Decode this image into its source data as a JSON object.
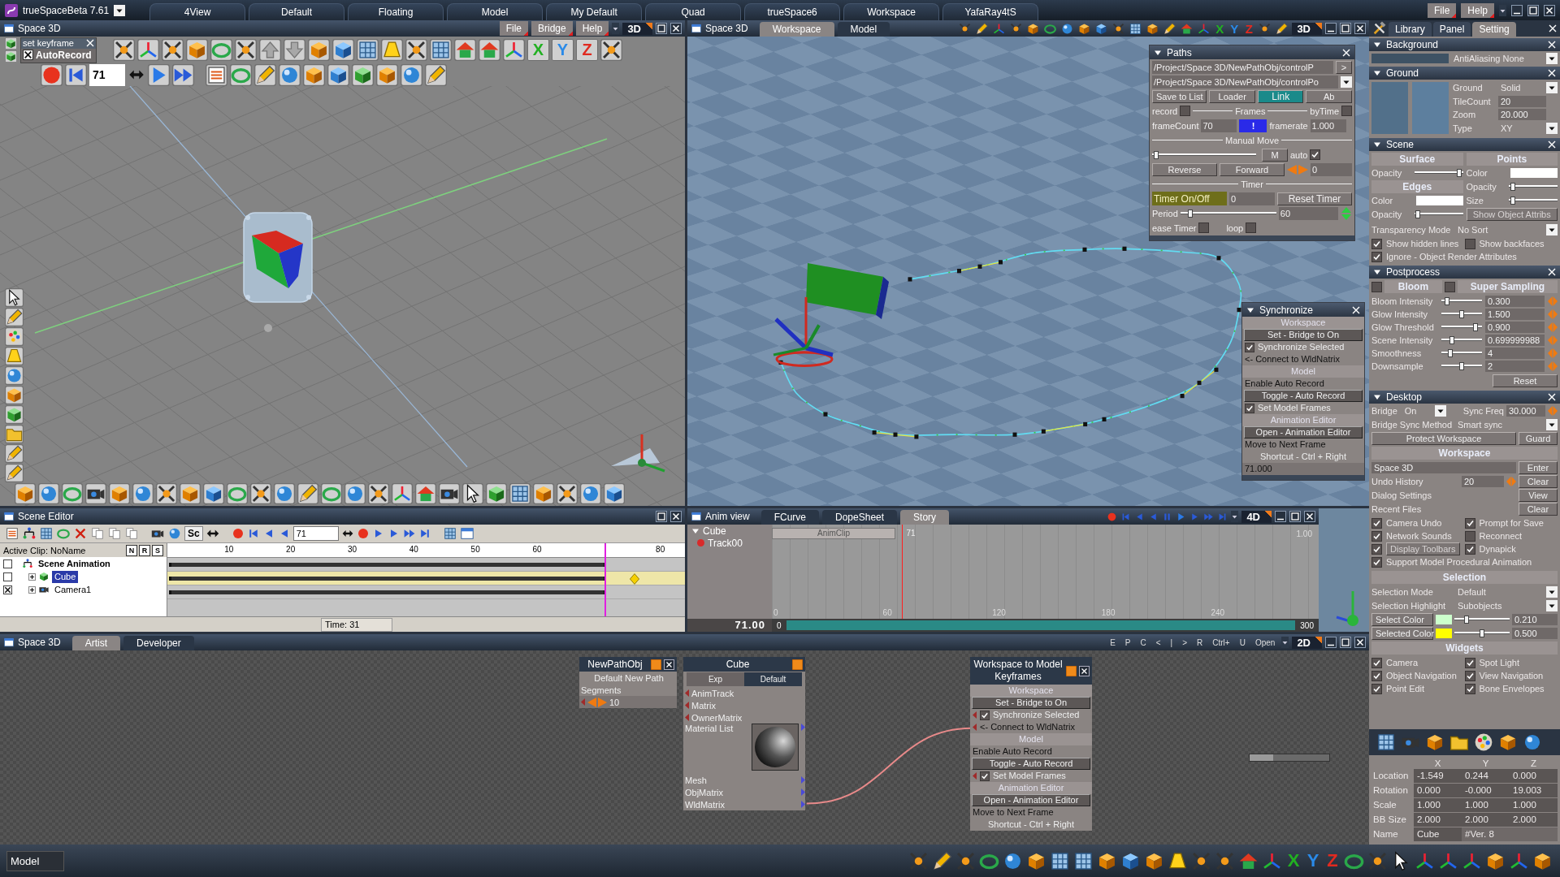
{
  "title_bar": {
    "app_title": "trueSpaceBeta 7.61",
    "layouts": [
      "4View",
      "Default",
      "Floating",
      "Model",
      "My Default",
      "Quad",
      "trueSpace6",
      "Workspace",
      "YafaRay4tS"
    ],
    "menu": [
      "File",
      "Help"
    ]
  },
  "model_view": {
    "title": "Space 3D",
    "menu": [
      "File",
      "Bridge",
      "Help"
    ],
    "mode": "3D",
    "keyframe": {
      "title": "set keyframe",
      "label": "AutoRecord",
      "checked": true
    },
    "axis_letters": [
      "X",
      "Y",
      "Z"
    ],
    "frame": "71"
  },
  "workspace_view": {
    "title": "Space 3D",
    "tabs": [
      {
        "label": "Workspace",
        "selected": true
      },
      {
        "label": "Model",
        "selected": false
      }
    ],
    "axis_letters": [
      "X",
      "Y",
      "Z"
    ],
    "mode": "3D"
  },
  "paths_panel": {
    "title": "Paths",
    "paths": [
      {
        "value": "/Project/Space 3D/NewPathObj/controlP",
        "kind": "button",
        "button": ">"
      },
      {
        "value": "/Project/Space 3D/NewPathObj/controlPo",
        "kind": "dropdown"
      }
    ],
    "buttons": [
      {
        "label": "Save to List",
        "selected": false
      },
      {
        "label": "Loader",
        "selected": false
      },
      {
        "label": "Link",
        "selected": true
      },
      {
        "label": "Ab",
        "selected": false
      }
    ],
    "record": {
      "label": "record",
      "checked": false
    },
    "frames_label": "Frames",
    "by_time": {
      "label": "byTime",
      "checked": false
    },
    "frame_count": {
      "label": "frameCount",
      "value": "70"
    },
    "apply": "!",
    "framerate": {
      "label": "framerate",
      "value": "1.000"
    },
    "manual_label": "Manual Move",
    "manual": {
      "level": 0.02
    },
    "m_button": "M",
    "auto": {
      "label": "auto",
      "checked": true
    },
    "reverse": "Reverse",
    "forward": "Forward",
    "step_value": "0",
    "timer_label": "Timer",
    "timer_toggle": {
      "label": "Timer On/Off",
      "on": true
    },
    "timer_value": "0",
    "reset": "Reset Timer",
    "period": {
      "label": "Period",
      "level": 0.08,
      "value": "60"
    },
    "ease": {
      "label": "ease Timer",
      "checked": false
    },
    "loop": {
      "label": "loop",
      "checked": false
    }
  },
  "sync_panel": {
    "title": "Synchronize",
    "rows": [
      {
        "kind": "header",
        "label": "Workspace"
      },
      {
        "kind": "button",
        "label": "Set - Bridge to On"
      },
      {
        "kind": "check",
        "label": "Synchronize Selected",
        "checked": true
      },
      {
        "kind": "input",
        "label": "<- Connect to WldNatrix"
      },
      {
        "kind": "header",
        "label": "Model"
      },
      {
        "kind": "text",
        "label": "Enable Auto Record"
      },
      {
        "kind": "button",
        "label": "Toggle - Auto Record"
      },
      {
        "kind": "check",
        "label": "Set Model Frames",
        "checked": true
      },
      {
        "kind": "header",
        "label": "Animation Editor"
      },
      {
        "kind": "button",
        "label": "Open - Animation Editor"
      },
      {
        "kind": "text",
        "label": "Move to Next Frame"
      },
      {
        "kind": "hint",
        "label": "Shortcut - Ctrl + Right"
      },
      {
        "kind": "value",
        "label": "71.000"
      }
    ]
  },
  "scene_editor": {
    "title": "Scene Editor",
    "tool_label": "Sc",
    "frame": "71",
    "active_clip": "Active Clip: NoName",
    "clip_buttons": [
      "N",
      "R",
      "S"
    ],
    "ruler": [
      "10",
      "20",
      "30",
      "40",
      "50",
      "60",
      "80"
    ],
    "playhead": {
      "level": 0.845
    },
    "tree": [
      {
        "label": "Scene Animation",
        "kind": "scene",
        "selected": false,
        "checked": false,
        "children": [
          {
            "label": "Cube",
            "kind": "mesh",
            "selected": true,
            "checked": false,
            "expanded": false
          },
          {
            "label": "Camera1",
            "kind": "camera",
            "selected": false,
            "checked": true,
            "expanded": false
          }
        ]
      }
    ],
    "time": "Time: 31"
  },
  "anim_view": {
    "title": "Anim view",
    "tabs": [
      {
        "label": "FCurve",
        "selected": false
      },
      {
        "label": "DopeSheet",
        "selected": false
      },
      {
        "label": "Story",
        "selected": true
      }
    ],
    "mode": "4D",
    "tree": [
      {
        "label": "Cube",
        "expanded": true,
        "children": [
          {
            "label": "Track00"
          }
        ]
      }
    ],
    "clip": "AnimClip",
    "clip_frame": "71",
    "clip_end": "1.00",
    "grid_labels": [
      "0",
      "60",
      "120",
      "180",
      "240"
    ],
    "frame": "71.00",
    "range_start": "0",
    "range_end": "300",
    "playhead": {
      "level": 0.237
    }
  },
  "node_editor": {
    "title": "Space 3D",
    "tabs": [
      {
        "label": "Artist",
        "selected": true
      },
      {
        "label": "Developer",
        "selected": false
      }
    ],
    "toolbar": [
      "E",
      "P",
      "C",
      "<",
      "|",
      ">",
      "R",
      "Ctrl+",
      "U",
      "Open"
    ],
    "mode": "2D",
    "nodes": [
      {
        "kind": "path",
        "title": "NewPathObj",
        "subtitle": "Default New Path",
        "field_label": "Segments",
        "value": "10"
      },
      {
        "kind": "object",
        "title": "Cube",
        "tabs": [
          {
            "label": "Exp",
            "selected": false
          },
          {
            "label": "Default",
            "selected": true
          }
        ],
        "inputs": [
          "AnimTrack",
          "Matrix",
          "OwnerMatrix"
        ],
        "material": "Material List",
        "outputs": [
          "Mesh",
          "ObjMatrix",
          "WldMatrix"
        ]
      },
      {
        "kind": "script",
        "title": "Workspace to Model Keyframes",
        "rows": [
          {
            "kind": "header",
            "label": "Workspace"
          },
          {
            "kind": "button",
            "label": "Set - Bridge to On"
          },
          {
            "kind": "check",
            "label": "Synchronize Selected",
            "checked": true
          },
          {
            "kind": "input",
            "label": "<- Connect to WldNatrix"
          },
          {
            "kind": "header",
            "label": "Model"
          },
          {
            "kind": "text",
            "label": "Enable Auto Record"
          },
          {
            "kind": "button",
            "label": "Toggle - Auto Record"
          },
          {
            "kind": "check",
            "label": "Set Model Frames",
            "checked": true
          },
          {
            "kind": "header",
            "label": "Animation Editor"
          },
          {
            "kind": "button",
            "label": "Open - Animation Editor"
          },
          {
            "kind": "text",
            "label": "Move to Next Frame"
          },
          {
            "kind": "hint",
            "label": "Shortcut - Ctrl + Right"
          }
        ]
      }
    ]
  },
  "settings": {
    "tabs": [
      {
        "label": "Library",
        "selected": false
      },
      {
        "label": "Panel",
        "selected": false
      },
      {
        "label": "Setting",
        "selected": true
      }
    ],
    "background": {
      "title": "Background",
      "color": "#3e5264",
      "antialiasing": "AntiAliasing None"
    },
    "ground": {
      "title": "Ground",
      "swatches": [
        {
          "color": "#52708a"
        },
        {
          "color": "#5d7f9e"
        }
      ],
      "fields": [
        {
          "label": "Ground",
          "value": "Solid",
          "kind": "dropdown"
        },
        {
          "label": "TileCount",
          "value": "20",
          "kind": "input"
        },
        {
          "label": "Zoom",
          "value": "20.000",
          "kind": "input"
        },
        {
          "label": "Type",
          "value": "XY",
          "kind": "dropdown"
        }
      ]
    },
    "scene": {
      "title": "Scene",
      "columns": [
        [
          {
            "kind": "header",
            "label": "Surface"
          },
          {
            "kind": "slider",
            "label": "Opacity",
            "level": 0.97
          },
          {
            "kind": "header",
            "label": "Edges"
          },
          {
            "kind": "color",
            "label": "Color",
            "color": "#ffffff"
          },
          {
            "kind": "slider",
            "label": "Opacity",
            "level": 0.03
          }
        ],
        [
          {
            "kind": "header",
            "label": "Points"
          },
          {
            "kind": "color",
            "label": "Color",
            "color": "#ffffff"
          },
          {
            "kind": "slider",
            "label": "Opacity",
            "level": 0.03
          },
          {
            "kind": "slider",
            "label": "Size",
            "level": 0.03
          },
          {
            "kind": "button",
            "label": "Show Object Attribs"
          }
        ]
      ],
      "transparency": {
        "label": "Transparency Mode",
        "value": "No Sort"
      },
      "checks": [
        {
          "label": "Show hidden lines",
          "checked": true
        },
        {
          "label": "Show backfaces",
          "checked": false
        },
        {
          "label": "Ignore - Object Render Attributes",
          "checked": true
        }
      ]
    },
    "postprocess": {
      "title": "Postprocess",
      "toggles": [
        {
          "label": "Bloom",
          "checked": false
        },
        {
          "label": "Super Sampling",
          "checked": false
        }
      ],
      "sliders": [
        {
          "label": "Bloom Intensity",
          "level": 0.1,
          "value": "0.300"
        },
        {
          "label": "Glow Intensity",
          "level": 0.5,
          "value": "1.500"
        },
        {
          "label": "Glow Threshold",
          "level": 0.88,
          "value": "0.900"
        },
        {
          "label": "Scene Intensity",
          "level": 0.22,
          "value": "0.699999988"
        },
        {
          "label": "Smoothness",
          "level": 0.18,
          "value": "4"
        },
        {
          "label": "Downsample",
          "level": 0.5,
          "value": "2"
        }
      ],
      "reset": "Reset"
    },
    "desktop": {
      "title": "Desktop",
      "bridge": {
        "label": "Bridge",
        "value": "On"
      },
      "sync_freq": {
        "label": "Sync Freq",
        "value": "30.000"
      },
      "sync_method": {
        "label": "Bridge Sync Method",
        "value": "Smart sync"
      },
      "protect": "Protect Workspace",
      "guard": "Guard",
      "workspace": {
        "title": "Workspace",
        "field": "Space 3D",
        "enter": "Enter",
        "rows": [
          {
            "label": "Undo History",
            "value": "20",
            "button": "Clear"
          },
          {
            "label": "Dialog Settings",
            "button": "View"
          },
          {
            "label": "Recent Files",
            "button": "Clear"
          }
        ],
        "checks": [
          {
            "kind": "check",
            "label": "Camera Undo",
            "checked": true
          },
          {
            "kind": "check",
            "label": "Prompt for Save",
            "checked": true
          },
          {
            "kind": "check",
            "label": "Network Sounds",
            "checked": true
          },
          {
            "kind": "check",
            "label": "Reconnect",
            "checked": false
          },
          {
            "kind": "button",
            "label": "Display Toolbars",
            "checked": true
          },
          {
            "kind": "check",
            "label": "Dynapick",
            "checked": true
          },
          {
            "kind": "check",
            "label": "Support Model Procedural Animation",
            "checked": true
          }
        ]
      },
      "selection": {
        "title": "Selection",
        "dropdowns": [
          {
            "label": "Selection Mode",
            "value": "Default"
          },
          {
            "label": "Selection Highlight",
            "value": "Subobjects"
          }
        ],
        "colors": [
          {
            "label": "Select Color",
            "color": "#ccffcc",
            "level": 0.2,
            "value": "0.210"
          },
          {
            "label": "Selected Color",
            "color": "#ffff00",
            "level": 0.5,
            "value": "0.500"
          }
        ]
      },
      "widgets": {
        "title": "Widgets",
        "checks": [
          {
            "label": "Camera",
            "checked": true
          },
          {
            "label": "Spot Light",
            "checked": true
          },
          {
            "label": "Object Navigation",
            "checked": true
          },
          {
            "label": "View Navigation",
            "checked": true
          },
          {
            "label": "Point Edit",
            "checked": true
          },
          {
            "label": "Bone Envelopes",
            "checked": true
          }
        ]
      }
    }
  },
  "transform": {
    "columns": [
      "X",
      "Y",
      "Z"
    ],
    "rows": [
      {
        "label": "Location",
        "values": [
          "-1.549",
          "0.244",
          "0.000"
        ]
      },
      {
        "label": "Rotation",
        "values": [
          "0.000",
          "-0.000",
          "19.003"
        ]
      },
      {
        "label": "Scale",
        "values": [
          "1.000",
          "1.000",
          "1.000"
        ]
      },
      {
        "label": "BB Size",
        "values": [
          "2.000",
          "2.000",
          "2.000"
        ]
      }
    ],
    "name_label": "Name",
    "name": "Cube",
    "version": "#Ver. 8"
  },
  "status_bar": {
    "mode": "Model",
    "axis_letters": [
      "X",
      "Y",
      "Z"
    ]
  }
}
